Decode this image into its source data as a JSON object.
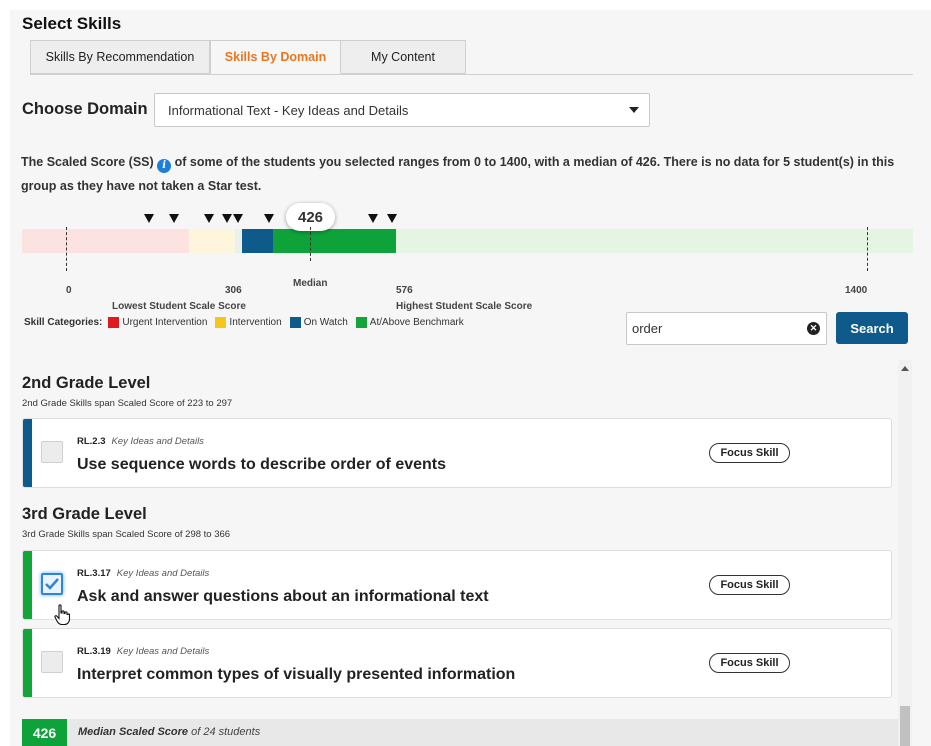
{
  "header": {
    "title": "Select Skills"
  },
  "tabs": [
    {
      "label": "Skills By Recommendation",
      "active": false
    },
    {
      "label": "Skills By Domain",
      "active": true
    },
    {
      "label": "My Content",
      "active": false
    }
  ],
  "domain": {
    "label": "Choose Domain",
    "selected": "Informational Text - Key Ideas and Details"
  },
  "description": {
    "part1": "The Scaled Score (SS)",
    "part2": " of some of the students you selected ranges from 0 to 1400, with a median of 426. There is no data for 5 student(s) in this group as they have not taken a Star test."
  },
  "score_bar": {
    "min": 0,
    "max": 1400,
    "median": 426,
    "median_bubble": "426",
    "median_label": "Median",
    "ticks": {
      "zero": "0",
      "low": "306",
      "high": "576",
      "max": "1400"
    },
    "lowest_label": "Lowest Student Scale Score",
    "highest_label": "Highest Student Scale Score"
  },
  "legend": {
    "title": "Skill Categories:",
    "items": [
      {
        "label": "Urgent Intervention",
        "color": "#e01b1b"
      },
      {
        "label": "Intervention",
        "color": "#f6c61b"
      },
      {
        "label": "On Watch",
        "color": "#0e5a8a"
      },
      {
        "label": "At/Above Benchmark",
        "color": "#12a53a"
      }
    ]
  },
  "search": {
    "value": "order",
    "button_label": "Search"
  },
  "groups": [
    {
      "heading": "2nd Grade Level",
      "subheading": "2nd Grade Skills span Scaled Score of 223 to 297",
      "skills": [
        {
          "code": "RL.2.3",
          "domain": "Key Ideas and Details",
          "name": "Use sequence words to describe order of events",
          "badge": "Focus Skill",
          "checked": false,
          "stripe_color": "#0e5a8a"
        }
      ]
    },
    {
      "heading": "3rd Grade Level",
      "subheading": "3rd Grade Skills span Scaled Score of 298 to 366",
      "skills": [
        {
          "code": "RL.3.17",
          "domain": "Key Ideas and Details",
          "name": "Ask and answer questions about an informational text",
          "badge": "Focus Skill",
          "checked": true,
          "stripe_color": "#12a53a"
        },
        {
          "code": "RL.3.19",
          "domain": "Key Ideas and Details",
          "name": "Interpret common types of visually presented information",
          "badge": "Focus Skill",
          "checked": false,
          "stripe_color": "#12a53a"
        }
      ]
    }
  ],
  "median_footer": {
    "value": "426",
    "label": "Median Scaled Score",
    "suffix": " of 24 students"
  }
}
